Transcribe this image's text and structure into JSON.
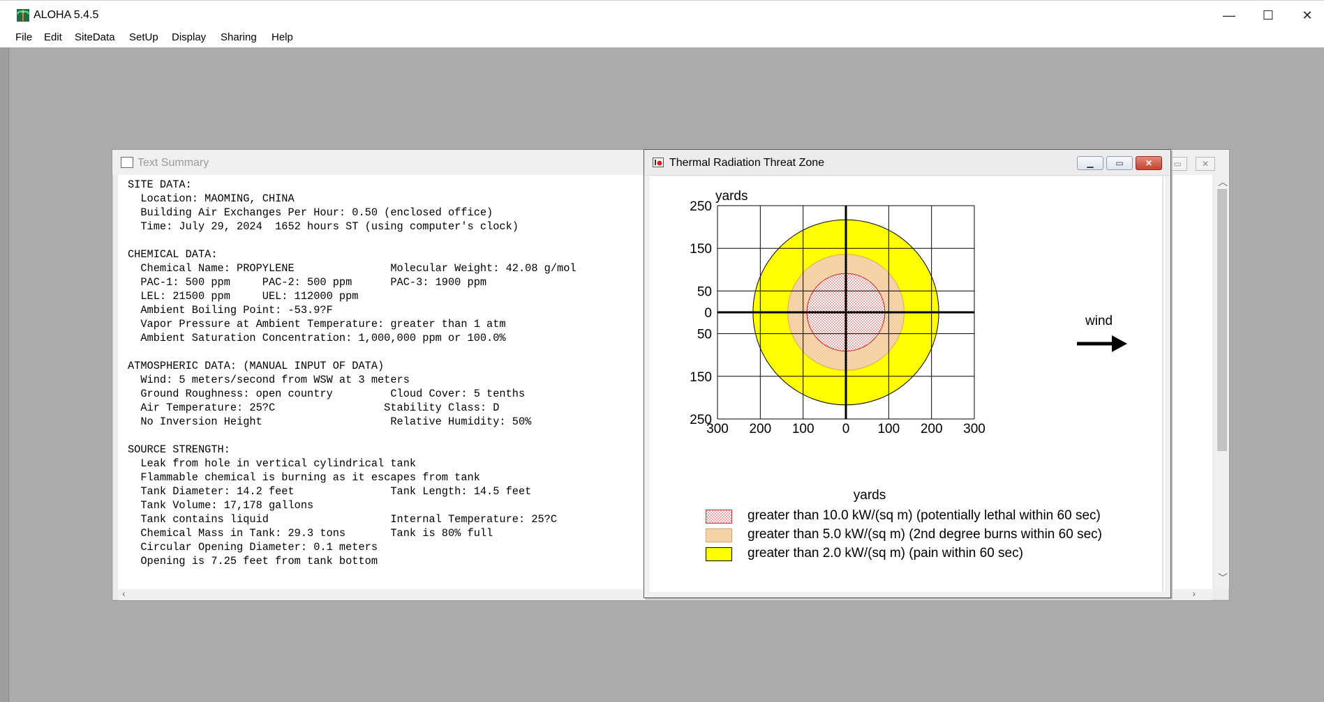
{
  "app": {
    "title": "ALOHA 5.4.5",
    "icon": "palm-tree-icon",
    "window_controls": {
      "minimize": "—",
      "maximize": "☐",
      "close": "✕"
    }
  },
  "menu": {
    "items": [
      {
        "label": "File"
      },
      {
        "label": "Edit"
      },
      {
        "label": "SiteData"
      },
      {
        "label": "SetUp"
      },
      {
        "label": "Display"
      },
      {
        "label": "Sharing"
      },
      {
        "label": "Help"
      }
    ]
  },
  "text_summary": {
    "title": "Text Summary",
    "lines": [
      "SITE DATA:",
      "  Location: MAOMING, CHINA",
      "  Building Air Exchanges Per Hour: 0.50 (enclosed office)",
      "  Time: July 29, 2024  1652 hours ST (using computer's clock)",
      "",
      "CHEMICAL DATA:",
      "  Chemical Name: PROPYLENE               Molecular Weight: 42.08 g/mol",
      "  PAC-1: 500 ppm     PAC-2: 500 ppm      PAC-3: 1900 ppm",
      "  LEL: 21500 ppm     UEL: 112000 ppm",
      "  Ambient Boiling Point: -53.9?F",
      "  Vapor Pressure at Ambient Temperature: greater than 1 atm",
      "  Ambient Saturation Concentration: 1,000,000 ppm or 100.0%",
      "",
      "ATMOSPHERIC DATA: (MANUAL INPUT OF DATA)",
      "  Wind: 5 meters/second from WSW at 3 meters",
      "  Ground Roughness: open country         Cloud Cover: 5 tenths",
      "  Air Temperature: 25?C                 Stability Class: D",
      "  No Inversion Height                    Relative Humidity: 50%",
      "",
      "SOURCE STRENGTH:",
      "  Leak from hole in vertical cylindrical tank",
      "  Flammable chemical is burning as it escapes from tank",
      "  Tank Diameter: 14.2 feet               Tank Length: 14.5 feet",
      "  Tank Volume: 17,178 gallons",
      "  Tank contains liquid                   Internal Temperature: 25?C",
      "  Chemical Mass in Tank: 29.3 tons       Tank is 80% full",
      "  Circular Opening Diameter: 0.1 meters",
      "  Opening is 7.25 feet from tank bottom"
    ]
  },
  "threat_zone": {
    "title": "Thermal Radiation Threat Zone",
    "wind_label": "wind",
    "colors": {
      "red_zone": "#e03030",
      "orange_zone": "#f8dcb8",
      "yellow_zone": "#ffff00"
    },
    "legend": [
      {
        "text": "greater than 10.0 kW/(sq m) (potentially lethal within 60 sec)",
        "zone": "red"
      },
      {
        "text": "greater than 5.0 kW/(sq m) (2nd degree burns within 60 sec)",
        "zone": "orange"
      },
      {
        "text": "greater than 2.0 kW/(sq m) (pain within 60 sec)",
        "zone": "yellow"
      }
    ]
  },
  "chart_data": {
    "type": "scatter",
    "title": "",
    "xlabel": "yards",
    "ylabel": "yards",
    "xlim": [
      -300,
      300
    ],
    "ylim": [
      -250,
      250
    ],
    "x_tick_labels": [
      "300",
      "200",
      "100",
      "0",
      "100",
      "200",
      "300"
    ],
    "y_tick_labels": [
      "250",
      "150",
      "50",
      "0",
      "50",
      "150",
      "250"
    ],
    "x_ticks": [
      -300,
      -200,
      -100,
      0,
      100,
      200,
      300
    ],
    "y_ticks": [
      250,
      150,
      50,
      0,
      -50,
      -150,
      -250
    ],
    "grid": true,
    "zones": [
      {
        "name": "greater than 2.0 kW/(sq m)",
        "radius": 217,
        "center": [
          0,
          0
        ]
      },
      {
        "name": "greater than 5.0 kW/(sq m)",
        "radius": 136,
        "center": [
          0,
          0
        ]
      },
      {
        "name": "greater than 10.0 kW/(sq m)",
        "radius": 91,
        "center": [
          0,
          0
        ]
      }
    ]
  }
}
